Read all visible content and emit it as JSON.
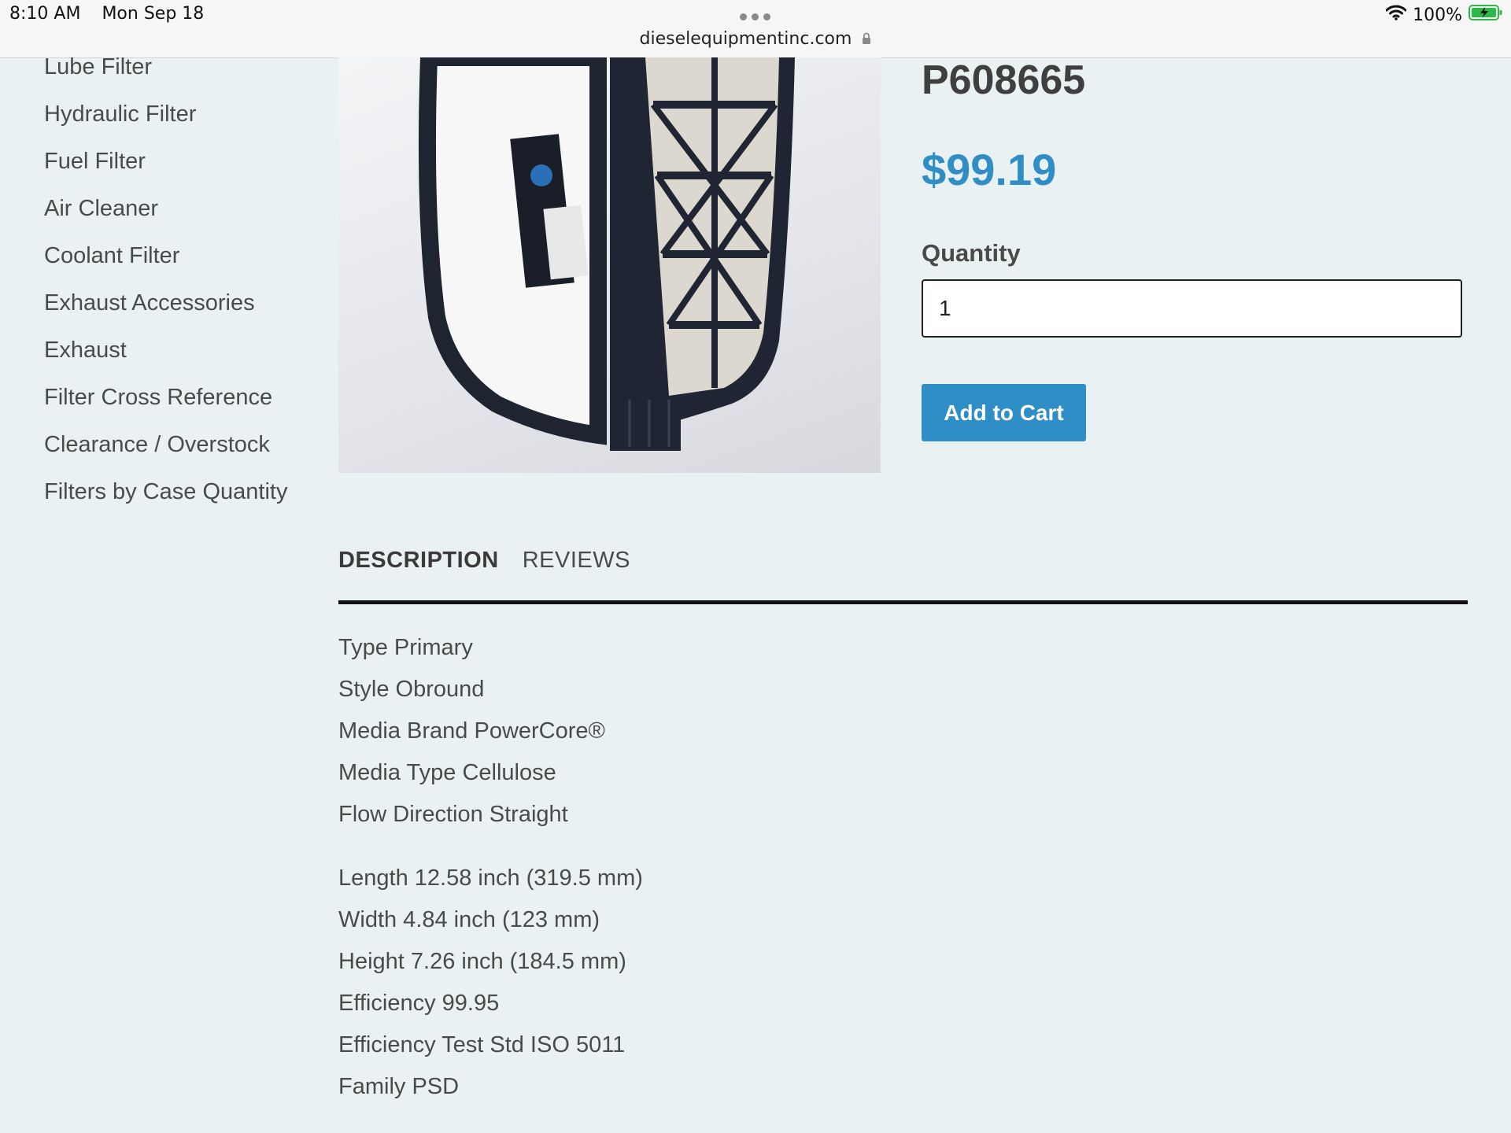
{
  "status_bar": {
    "time": "8:10 AM",
    "date": "Mon Sep 18",
    "battery": "100%"
  },
  "browser": {
    "url": "dieselequipmentinc.com"
  },
  "sidebar": {
    "items": [
      {
        "label": "Lube Filter"
      },
      {
        "label": "Hydraulic Filter"
      },
      {
        "label": "Fuel Filter"
      },
      {
        "label": "Air Cleaner"
      },
      {
        "label": "Coolant Filter"
      },
      {
        "label": "Exhaust Accessories"
      },
      {
        "label": "Exhaust"
      },
      {
        "label": "Filter Cross Reference"
      },
      {
        "label": "Clearance / Overstock"
      },
      {
        "label": "Filters by Case Quantity"
      }
    ]
  },
  "product": {
    "sku": "P608665",
    "price": "$99.19",
    "quantity_label": "Quantity",
    "quantity_value": "1",
    "add_to_cart_label": "Add to Cart",
    "image_icon": "air-filter-product-photo"
  },
  "tabs": [
    {
      "label": "DESCRIPTION",
      "active": true
    },
    {
      "label": "REVIEWS",
      "active": false
    }
  ],
  "description": {
    "group1": [
      "Type Primary",
      "Style Obround",
      "Media Brand PowerCore®",
      "Media Type Cellulose",
      "Flow Direction Straight"
    ],
    "group2": [
      "Length 12.58 inch (319.5 mm)",
      "Width 4.84 inch (123 mm)",
      "Height 7.26 inch (184.5 mm)",
      "Efficiency 99.95",
      "Efficiency Test Std ISO 5011",
      "Family PSD"
    ]
  },
  "colors": {
    "accent": "#2f8ec5",
    "background": "#eaf1f3",
    "text": "#4a4a4a"
  }
}
